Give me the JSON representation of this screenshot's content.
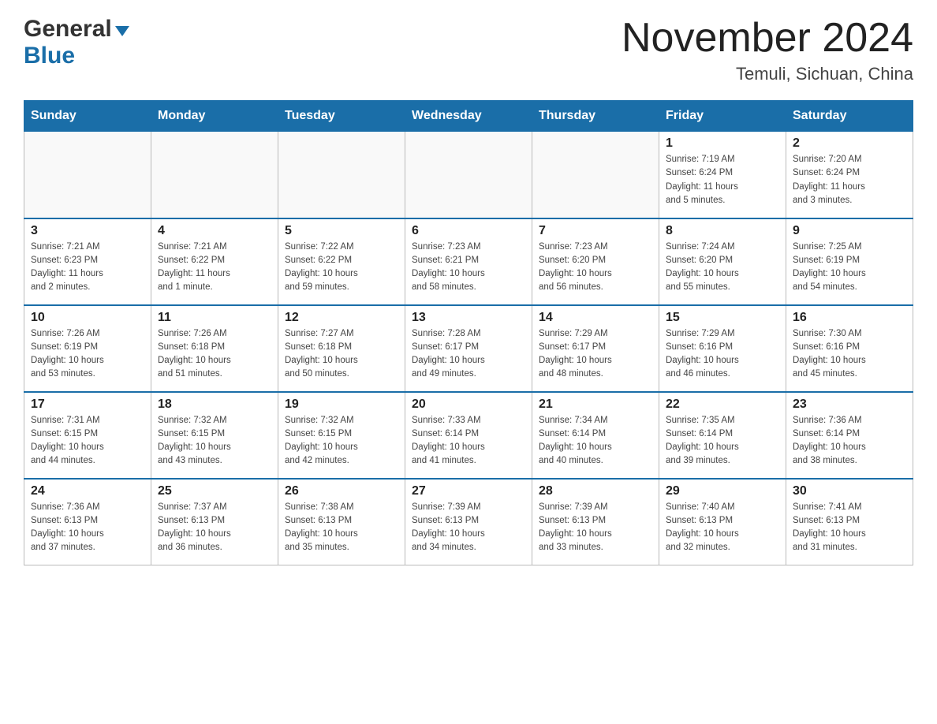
{
  "header": {
    "logo_general": "General",
    "logo_blue": "Blue",
    "month_title": "November 2024",
    "location": "Temuli, Sichuan, China"
  },
  "weekdays": [
    "Sunday",
    "Monday",
    "Tuesday",
    "Wednesday",
    "Thursday",
    "Friday",
    "Saturday"
  ],
  "weeks": [
    {
      "days": [
        {
          "num": "",
          "info": ""
        },
        {
          "num": "",
          "info": ""
        },
        {
          "num": "",
          "info": ""
        },
        {
          "num": "",
          "info": ""
        },
        {
          "num": "",
          "info": ""
        },
        {
          "num": "1",
          "info": "Sunrise: 7:19 AM\nSunset: 6:24 PM\nDaylight: 11 hours\nand 5 minutes."
        },
        {
          "num": "2",
          "info": "Sunrise: 7:20 AM\nSunset: 6:24 PM\nDaylight: 11 hours\nand 3 minutes."
        }
      ]
    },
    {
      "days": [
        {
          "num": "3",
          "info": "Sunrise: 7:21 AM\nSunset: 6:23 PM\nDaylight: 11 hours\nand 2 minutes."
        },
        {
          "num": "4",
          "info": "Sunrise: 7:21 AM\nSunset: 6:22 PM\nDaylight: 11 hours\nand 1 minute."
        },
        {
          "num": "5",
          "info": "Sunrise: 7:22 AM\nSunset: 6:22 PM\nDaylight: 10 hours\nand 59 minutes."
        },
        {
          "num": "6",
          "info": "Sunrise: 7:23 AM\nSunset: 6:21 PM\nDaylight: 10 hours\nand 58 minutes."
        },
        {
          "num": "7",
          "info": "Sunrise: 7:23 AM\nSunset: 6:20 PM\nDaylight: 10 hours\nand 56 minutes."
        },
        {
          "num": "8",
          "info": "Sunrise: 7:24 AM\nSunset: 6:20 PM\nDaylight: 10 hours\nand 55 minutes."
        },
        {
          "num": "9",
          "info": "Sunrise: 7:25 AM\nSunset: 6:19 PM\nDaylight: 10 hours\nand 54 minutes."
        }
      ]
    },
    {
      "days": [
        {
          "num": "10",
          "info": "Sunrise: 7:26 AM\nSunset: 6:19 PM\nDaylight: 10 hours\nand 53 minutes."
        },
        {
          "num": "11",
          "info": "Sunrise: 7:26 AM\nSunset: 6:18 PM\nDaylight: 10 hours\nand 51 minutes."
        },
        {
          "num": "12",
          "info": "Sunrise: 7:27 AM\nSunset: 6:18 PM\nDaylight: 10 hours\nand 50 minutes."
        },
        {
          "num": "13",
          "info": "Sunrise: 7:28 AM\nSunset: 6:17 PM\nDaylight: 10 hours\nand 49 minutes."
        },
        {
          "num": "14",
          "info": "Sunrise: 7:29 AM\nSunset: 6:17 PM\nDaylight: 10 hours\nand 48 minutes."
        },
        {
          "num": "15",
          "info": "Sunrise: 7:29 AM\nSunset: 6:16 PM\nDaylight: 10 hours\nand 46 minutes."
        },
        {
          "num": "16",
          "info": "Sunrise: 7:30 AM\nSunset: 6:16 PM\nDaylight: 10 hours\nand 45 minutes."
        }
      ]
    },
    {
      "days": [
        {
          "num": "17",
          "info": "Sunrise: 7:31 AM\nSunset: 6:15 PM\nDaylight: 10 hours\nand 44 minutes."
        },
        {
          "num": "18",
          "info": "Sunrise: 7:32 AM\nSunset: 6:15 PM\nDaylight: 10 hours\nand 43 minutes."
        },
        {
          "num": "19",
          "info": "Sunrise: 7:32 AM\nSunset: 6:15 PM\nDaylight: 10 hours\nand 42 minutes."
        },
        {
          "num": "20",
          "info": "Sunrise: 7:33 AM\nSunset: 6:14 PM\nDaylight: 10 hours\nand 41 minutes."
        },
        {
          "num": "21",
          "info": "Sunrise: 7:34 AM\nSunset: 6:14 PM\nDaylight: 10 hours\nand 40 minutes."
        },
        {
          "num": "22",
          "info": "Sunrise: 7:35 AM\nSunset: 6:14 PM\nDaylight: 10 hours\nand 39 minutes."
        },
        {
          "num": "23",
          "info": "Sunrise: 7:36 AM\nSunset: 6:14 PM\nDaylight: 10 hours\nand 38 minutes."
        }
      ]
    },
    {
      "days": [
        {
          "num": "24",
          "info": "Sunrise: 7:36 AM\nSunset: 6:13 PM\nDaylight: 10 hours\nand 37 minutes."
        },
        {
          "num": "25",
          "info": "Sunrise: 7:37 AM\nSunset: 6:13 PM\nDaylight: 10 hours\nand 36 minutes."
        },
        {
          "num": "26",
          "info": "Sunrise: 7:38 AM\nSunset: 6:13 PM\nDaylight: 10 hours\nand 35 minutes."
        },
        {
          "num": "27",
          "info": "Sunrise: 7:39 AM\nSunset: 6:13 PM\nDaylight: 10 hours\nand 34 minutes."
        },
        {
          "num": "28",
          "info": "Sunrise: 7:39 AM\nSunset: 6:13 PM\nDaylight: 10 hours\nand 33 minutes."
        },
        {
          "num": "29",
          "info": "Sunrise: 7:40 AM\nSunset: 6:13 PM\nDaylight: 10 hours\nand 32 minutes."
        },
        {
          "num": "30",
          "info": "Sunrise: 7:41 AM\nSunset: 6:13 PM\nDaylight: 10 hours\nand 31 minutes."
        }
      ]
    }
  ]
}
